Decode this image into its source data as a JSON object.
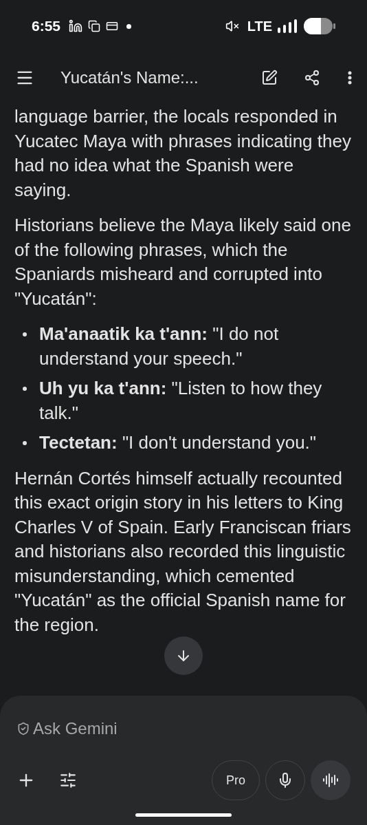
{
  "status_bar": {
    "time": "6:55",
    "network": "LTE"
  },
  "app_bar": {
    "title": "Yucatán's Name:..."
  },
  "content": [
    {
      "kind": "paragraph",
      "text": "language barrier, the locals responded in Yucatec Maya with phrases indicating they had no idea what the Spanish were saying."
    },
    {
      "kind": "paragraph",
      "text": "Historians believe the Maya likely said one of the following phrases, which the Spaniards misheard and corrupted into \"Yucatán\":"
    },
    {
      "kind": "bullets",
      "items": [
        "**Ma'anaatik ka t'ann:** \"I do not understand your speech.\"",
        "**Uh yu ka t'ann:** \"Listen to how they talk.\"",
        "**Tectetan:** \"I don't understand you.\""
      ]
    },
    {
      "kind": "paragraph",
      "text": "Hernán Cortés himself actually recounted this exact origin story in his letters to King Charles V of Spain. Early Franciscan friars and historians also recorded this linguistic misunderstanding, which cemented \"Yucatán\" as the official Spanish name for the region."
    }
  ],
  "composer": {
    "placeholder": "Ask Gemini",
    "model_button": "Pro"
  }
}
